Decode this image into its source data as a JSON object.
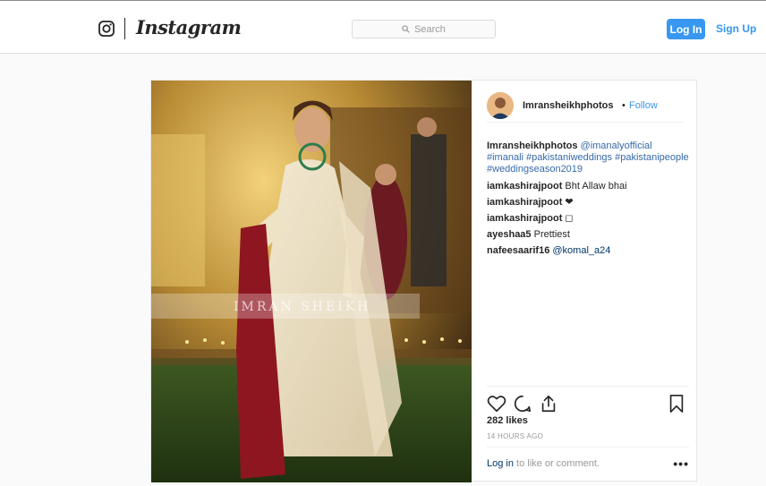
{
  "header": {
    "wordmark": "Instagram",
    "search_placeholder": "Search",
    "login_label": "Log In",
    "signup_label": "Sign Up",
    "icons": [
      "instagram-camera-icon",
      "search-icon"
    ],
    "accent_color": "#3897f0"
  },
  "post": {
    "username": "Imransheikhphotos",
    "dot": "•",
    "follow_label": "Follow",
    "photo_watermark": "IMRAN SHEIKH",
    "caption": {
      "user": "Imransheikhphotos",
      "parts": [
        "@imanalyofficial",
        "#imanali",
        "#pakistaniweddings",
        "#pakistanipeople",
        "#weddingseason2019"
      ]
    },
    "comments": [
      {
        "user": "iamkashirajpoot",
        "text": "Bht Allaw bhai"
      },
      {
        "user": "iamkashirajpoot",
        "text": "❤"
      },
      {
        "user": "iamkashirajpoot",
        "text": "◻"
      },
      {
        "user": "ayeshaa5",
        "text": "Prettiest"
      },
      {
        "user": "nafeesaarif16",
        "text": "@komal_a24"
      }
    ],
    "likes": "282 likes",
    "time": "14 HOURS AGO",
    "footer_login": "Log in",
    "footer_rest": "to like or comment.",
    "more_label": "•••",
    "action_icons": [
      "heart-icon",
      "comment-icon",
      "share-icon",
      "bookmark-icon"
    ]
  }
}
